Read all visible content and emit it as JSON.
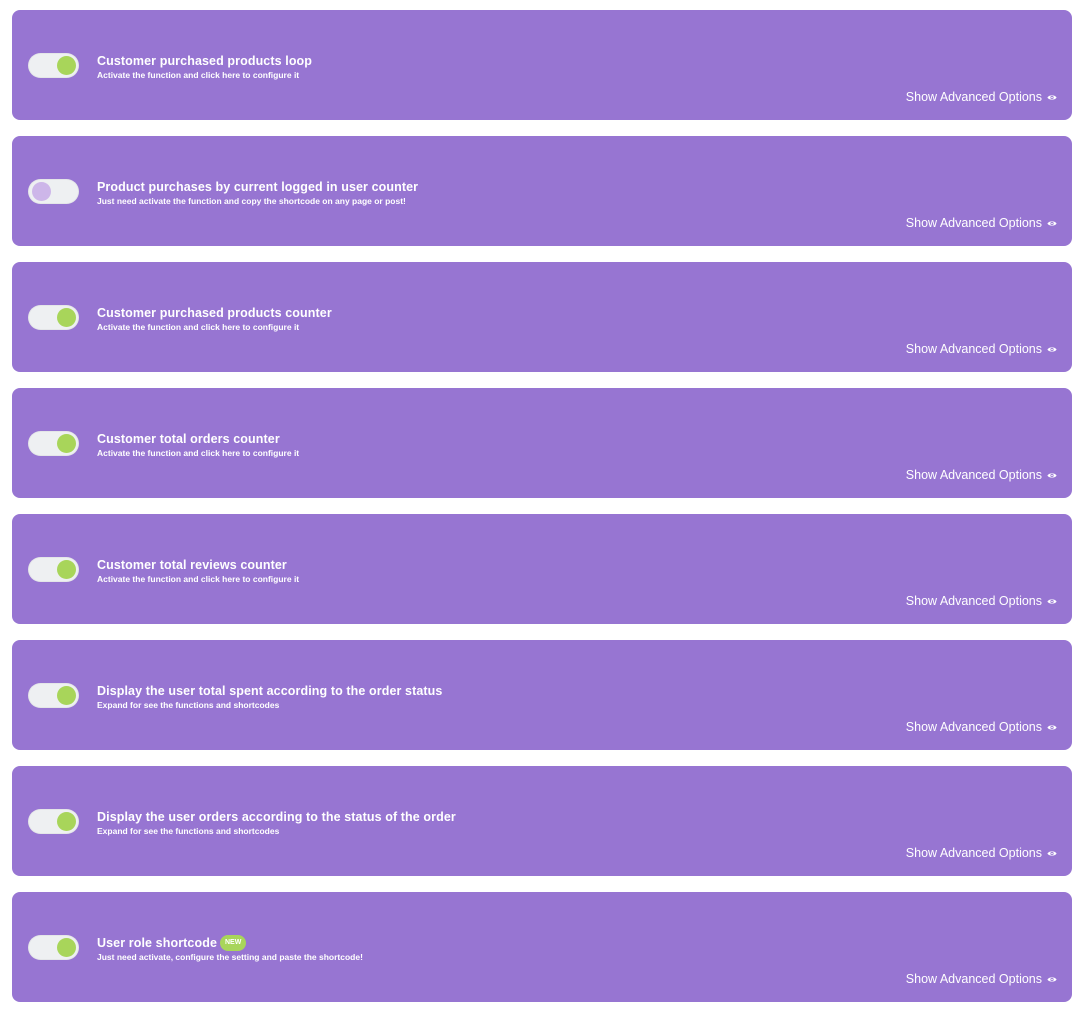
{
  "colors": {
    "card_bg": "#9775d2",
    "toggle_track": "#eef0f2",
    "toggle_on_knob": "#a8d55a",
    "toggle_off_knob": "#cdb6e9",
    "text": "#ffffff",
    "badge_bg": "#a8d55a"
  },
  "advanced_icon": "eye-icon",
  "items": [
    {
      "title": "Customer purchased products loop",
      "subtitle": "Activate the function and click here to configure it",
      "enabled": true,
      "badge": null,
      "advanced_label": "Show Advanced Options"
    },
    {
      "title": "Product purchases by current logged in user counter",
      "subtitle": "Just need activate the function and copy the shortcode on any page or post!",
      "enabled": false,
      "badge": null,
      "advanced_label": "Show Advanced Options"
    },
    {
      "title": "Customer purchased products counter",
      "subtitle": "Activate the function and click here to configure it",
      "enabled": true,
      "badge": null,
      "advanced_label": "Show Advanced Options"
    },
    {
      "title": "Customer total orders counter",
      "subtitle": "Activate the function and click here to configure it",
      "enabled": true,
      "badge": null,
      "advanced_label": "Show Advanced Options"
    },
    {
      "title": "Customer total reviews counter",
      "subtitle": "Activate the function and click here to configure it",
      "enabled": true,
      "badge": null,
      "advanced_label": "Show Advanced Options"
    },
    {
      "title": "Display the user total spent according to the order status",
      "subtitle": "Expand for see the functions and shortcodes",
      "enabled": true,
      "badge": null,
      "advanced_label": "Show Advanced Options"
    },
    {
      "title": "Display the user orders according to the status of the order",
      "subtitle": "Expand for see the functions and shortcodes",
      "enabled": true,
      "badge": null,
      "advanced_label": "Show Advanced Options"
    },
    {
      "title": "User role shortcode",
      "subtitle": "Just need activate, configure the setting and paste the shortcode!",
      "enabled": true,
      "badge": "NEW",
      "advanced_label": "Show Advanced Options"
    }
  ]
}
